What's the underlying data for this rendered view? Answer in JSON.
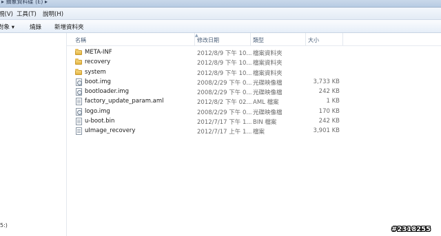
{
  "window": {
    "title": "▸ 抽象資料碟 (E) ▸"
  },
  "menu": [
    "視(V)",
    "工具(T)",
    "說明(H)"
  ],
  "toolbar": [
    "對象 ▾",
    "燒錄",
    "新增資料夾"
  ],
  "columns": {
    "name": "名稱",
    "date": "修改日期",
    "type": "類型",
    "size": "大小"
  },
  "files": [
    {
      "icon": "folder-icon",
      "name": "META-INF",
      "date": "2012/8/9 下午 10...",
      "type": "檔案資料夾",
      "size": ""
    },
    {
      "icon": "folder-icon",
      "name": "recovery",
      "date": "2012/8/9 下午 10...",
      "type": "檔案資料夾",
      "size": ""
    },
    {
      "icon": "folder-icon",
      "name": "system",
      "date": "2012/8/9 下午 10...",
      "type": "檔案資料夾",
      "size": ""
    },
    {
      "icon": "disc-image-icon",
      "name": "boot.img",
      "date": "2008/2/29 下午 0...",
      "type": "光碟映像檔",
      "size": "3,733 KB"
    },
    {
      "icon": "disc-image-icon",
      "name": "bootloader.img",
      "date": "2008/2/29 下午 0...",
      "type": "光碟映像檔",
      "size": "242 KB"
    },
    {
      "icon": "file-icon",
      "name": "factory_update_param.aml",
      "date": "2012/8/2 下午 02...",
      "type": "AML 檔案",
      "size": "1 KB"
    },
    {
      "icon": "disc-image-icon",
      "name": "logo.img",
      "date": "2008/2/29 下午 0...",
      "type": "光碟映像檔",
      "size": "170 KB"
    },
    {
      "icon": "file-icon",
      "name": "u-boot.bin",
      "date": "2012/7/17 下午 1...",
      "type": "BIN 檔案",
      "size": "242 KB"
    },
    {
      "icon": "file-icon",
      "name": "uImage_recovery",
      "date": "2012/7/17 上午 1...",
      "type": "檔案",
      "size": "3,901 KB"
    }
  ],
  "nav": {
    "bottom_label": "5:)"
  },
  "watermark": "#2318255"
}
